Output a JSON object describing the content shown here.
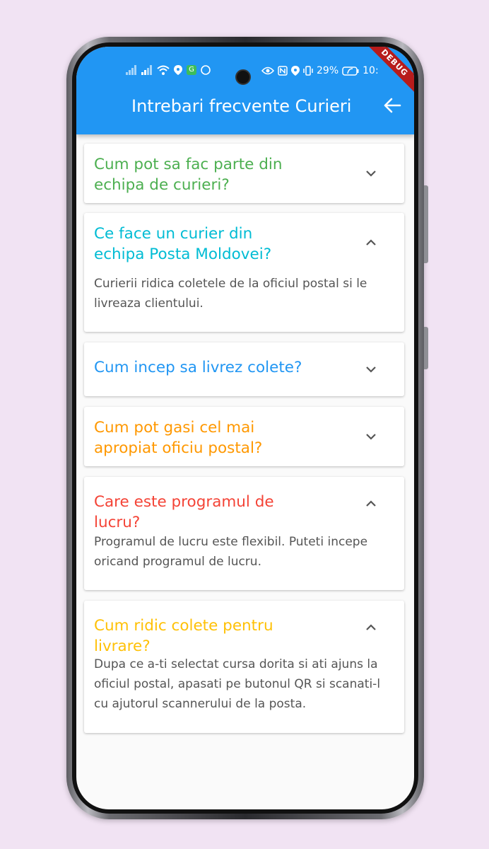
{
  "status": {
    "battery": "29%",
    "time": "10:",
    "debug": "DEBUG"
  },
  "header": {
    "title": "Intrebari frecvente Curieri"
  },
  "faqs": [
    {
      "question": "Cum pot sa fac parte din echipa de curieri?",
      "color": "#4caf50",
      "expanded": false,
      "answer": ""
    },
    {
      "question": "Ce face un curier din echipa Posta Moldovei?",
      "color": "#00bcd4",
      "expanded": true,
      "answer": "Curierii ridica coletele de la oficiul postal si le livreaza clientului."
    },
    {
      "question": "Cum incep sa livrez colete?",
      "color": "#2196f3",
      "expanded": false,
      "answer": ""
    },
    {
      "question": "Cum pot gasi cel mai apropiat oficiu postal?",
      "color": "#ff9800",
      "expanded": false,
      "answer": ""
    },
    {
      "question": "Care este programul de lucru?",
      "color": "#f44336",
      "expanded": true,
      "answer": "Programul de lucru este flexibil. Puteti incepe oricand programul de lucru."
    },
    {
      "question": "Cum ridic colete pentru livrare?",
      "color": "#ffc107",
      "expanded": true,
      "answer": "Dupa ce a-ti selectat cursa dorita si ati ajuns la oficiul postal, apasati pe butonul QR si scanati-l cu ajutorul scannerului de la posta."
    }
  ]
}
